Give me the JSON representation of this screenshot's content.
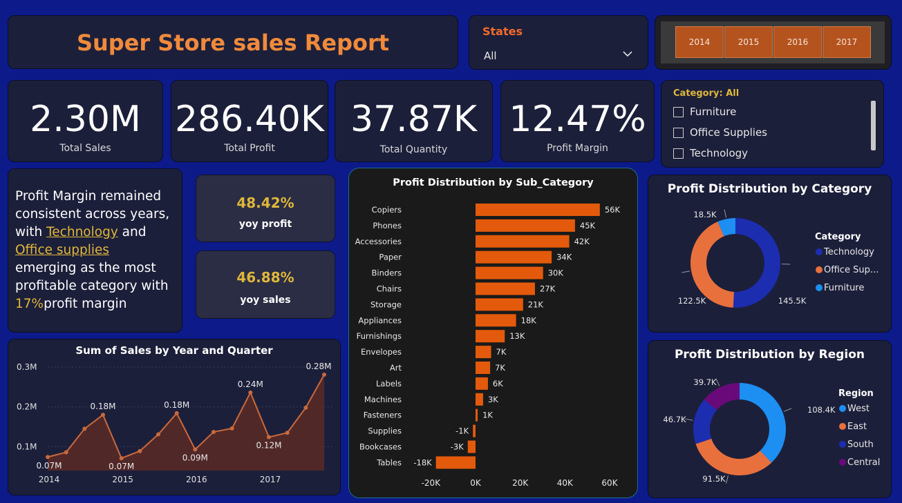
{
  "header": {
    "title": "Super Store sales Report"
  },
  "states_filter": {
    "label": "States",
    "value": "All"
  },
  "year_slicer": {
    "years": [
      "2014",
      "2015",
      "2016",
      "2017"
    ]
  },
  "kpis": [
    {
      "value": "2.30M",
      "label": "Total Sales"
    },
    {
      "value": "286.40K",
      "label": "Total Profit"
    },
    {
      "value": "37.87K",
      "label": "Total Quantity"
    },
    {
      "value": "12.47%",
      "label": "Profit Margin"
    }
  ],
  "category_filter": {
    "title": "Category: All",
    "items": [
      "Furniture",
      "Office Supplies",
      "Technology"
    ]
  },
  "insight": {
    "part1": "Profit Margin remained consistent across years, with ",
    "hl1": "Technology",
    "part2": " and ",
    "hl2": "Office supplies",
    "part3": " emerging as the most profitable category with ",
    "hl3": "17%",
    "part4": "profit margin"
  },
  "yoy": [
    {
      "value": "48.42%",
      "label": "yoy profit"
    },
    {
      "value": "46.88%",
      "label": "yoy sales"
    }
  ],
  "colors": {
    "accent": "#f08a3b",
    "bar": "#e35a0c",
    "area_line": "#c96a3c",
    "area_fill": "#5a2a26",
    "technology": "#1c2db0",
    "office": "#e8703d",
    "furniture": "#1d8ff2",
    "west": "#1d8ff2",
    "east": "#e8703d",
    "south": "#1c2db0",
    "central": "#6a0a7a"
  },
  "chart_data": [
    {
      "type": "line",
      "title": "Sum of Sales by Year and Quarter",
      "x_tick_labels": [
        "2014",
        "2015",
        "2016",
        "2017"
      ],
      "y_tick_labels": [
        "0.1M",
        "0.2M",
        "0.3M"
      ],
      "ylim": [
        0.04,
        0.3
      ],
      "x": [
        "2014 Q1",
        "2014 Q2",
        "2014 Q3",
        "2014 Q4",
        "2015 Q1",
        "2015 Q2",
        "2015 Q3",
        "2015 Q4",
        "2016 Q1",
        "2016 Q2",
        "2016 Q3",
        "2016 Q4",
        "2017 Q1",
        "2017 Q2",
        "2017 Q3",
        "2017 Q4"
      ],
      "values": [
        0.074,
        0.086,
        0.145,
        0.18,
        0.071,
        0.089,
        0.131,
        0.184,
        0.093,
        0.137,
        0.146,
        0.236,
        0.124,
        0.135,
        0.198,
        0.281
      ],
      "point_labels": [
        {
          "index": 0,
          "text": "0.07M"
        },
        {
          "index": 3,
          "text": "0.18M"
        },
        {
          "index": 4,
          "text": "0.07M"
        },
        {
          "index": 7,
          "text": "0.18M"
        },
        {
          "index": 8,
          "text": "0.09M"
        },
        {
          "index": 11,
          "text": "0.24M"
        },
        {
          "index": 12,
          "text": "0.12M"
        },
        {
          "index": 15,
          "text": "0.28M"
        }
      ]
    },
    {
      "type": "bar",
      "orientation": "horizontal",
      "title": "Profit Distribution by Sub_Category",
      "categories": [
        "Copiers",
        "Phones",
        "Accessories",
        "Paper",
        "Binders",
        "Chairs",
        "Storage",
        "Appliances",
        "Furnishings",
        "Envelopes",
        "Art",
        "Labels",
        "Machines",
        "Fasteners",
        "Supplies",
        "Bookcases",
        "Tables"
      ],
      "values": [
        55618,
        44516,
        41937,
        34054,
        30222,
        26590,
        21279,
        18138,
        13059,
        6964,
        6528,
        5546,
        3385,
        950,
        -1189,
        -3473,
        -17725
      ],
      "data_labels": [
        "56K",
        "45K",
        "42K",
        "34K",
        "30K",
        "27K",
        "21K",
        "18K",
        "13K",
        "7K",
        "7K",
        "6K",
        "3K",
        "1K",
        "-1K",
        "-3K",
        "-18K"
      ],
      "x_tick_labels": [
        "-20K",
        "0K",
        "20K",
        "40K",
        "60K"
      ],
      "xlim": [
        -20000,
        60000
      ]
    },
    {
      "type": "pie",
      "title": "Profit Distribution by Category",
      "legend_title": "Category",
      "labels": [
        "Technology",
        "Office Sup...",
        "Furniture"
      ],
      "values": [
        145.5,
        122.5,
        18.5
      ],
      "value_labels": [
        "145.5K",
        "122.5K",
        "18.5K"
      ]
    },
    {
      "type": "pie",
      "title": "Profit Distribution by Region",
      "legend_title": "Region",
      "labels": [
        "West",
        "East",
        "South",
        "Central"
      ],
      "values": [
        108.4,
        91.5,
        46.7,
        39.7
      ],
      "value_labels": [
        "108.4K",
        "91.5K",
        "46.7K",
        "39.7K"
      ]
    }
  ]
}
